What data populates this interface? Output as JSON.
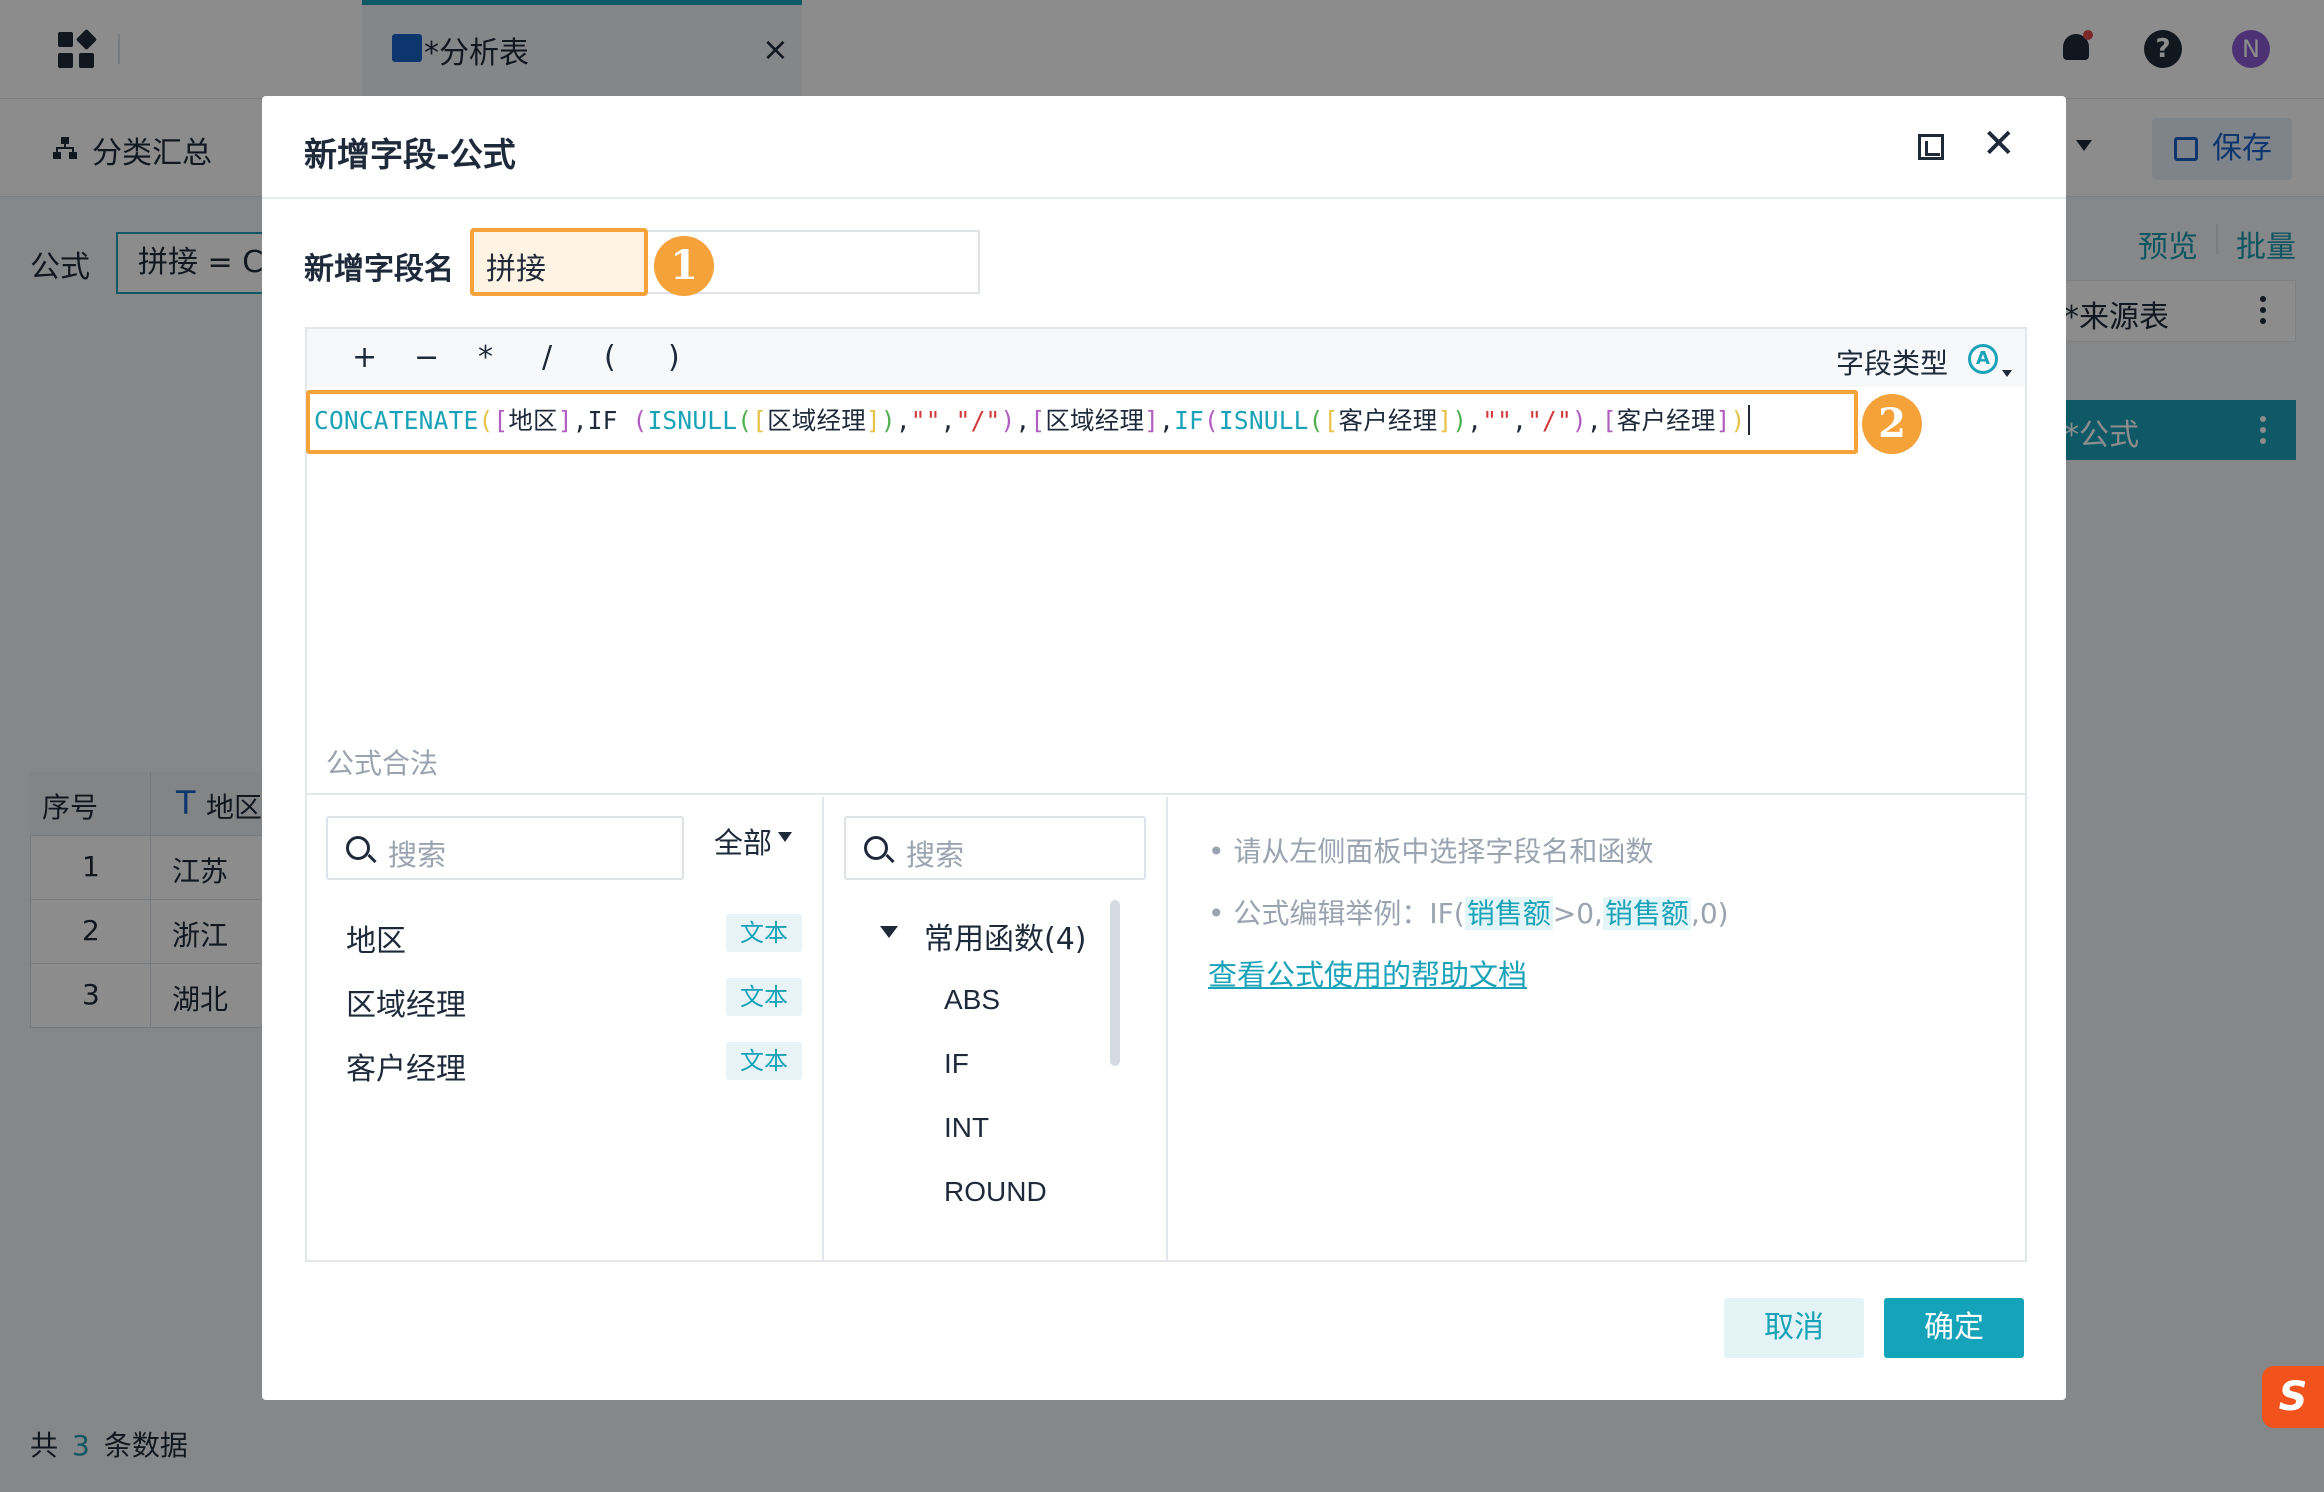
{
  "header": {
    "tab_title": "*分析表",
    "tab_close": "×",
    "help_glyph": "?",
    "avatar_initial": "N"
  },
  "toolbar": {
    "group_summary_label": "分类汇总",
    "save_label": "保存"
  },
  "formula_bar": {
    "label": "公式",
    "value": "拼接 = CONCATENATE([地区],IF (ISNULL([区域经理]),\"\",\"/\"),[区域经理],IF(ISNULL([客户经理]),\"\",\"/\"),[客户经理])"
  },
  "right_panel": {
    "preview": "预览",
    "batch": "批量",
    "steps": [
      "*来源表",
      "*公式"
    ]
  },
  "table": {
    "headers": [
      "序号",
      "地区"
    ],
    "type_glyph": "T",
    "rows": [
      [
        "1",
        "江苏"
      ],
      [
        "2",
        "浙江"
      ],
      [
        "3",
        "湖北"
      ]
    ]
  },
  "footer": {
    "prefix": "共",
    "count": "3",
    "suffix": "条数据"
  },
  "dialog": {
    "title": "新增字段-公式",
    "field_name_label": "新增字段名",
    "field_name_value": "拼接",
    "badge_1": "1",
    "badge_2": "2",
    "operators": [
      "+",
      "−",
      "*",
      "/",
      "(",
      ")"
    ],
    "field_type_label": "字段类型",
    "field_type_icon": "A",
    "validity": "公式合法",
    "field_search_placeholder": "搜索",
    "filter_label": "全部",
    "fields": [
      {
        "name": "地区",
        "type": "文本"
      },
      {
        "name": "区域经理",
        "type": "文本"
      },
      {
        "name": "客户经理",
        "type": "文本"
      }
    ],
    "func_search_placeholder": "搜索",
    "func_group": "常用函数(4)",
    "functions": [
      "ABS",
      "IF",
      "INT",
      "ROUND"
    ],
    "hint_1": "• 请从左侧面板中选择字段名和函数",
    "hint_2_prefix": "• 公式编辑举例：IF(",
    "hint_2_field": "销售额",
    "hint_2_mid": ">0,",
    "hint_2_field2": "销售额",
    "hint_2_suffix": ",0)",
    "help_link": "查看公式使用的帮助文档",
    "cancel": "取消",
    "ok": "确定"
  },
  "sogou_glyph": "S"
}
